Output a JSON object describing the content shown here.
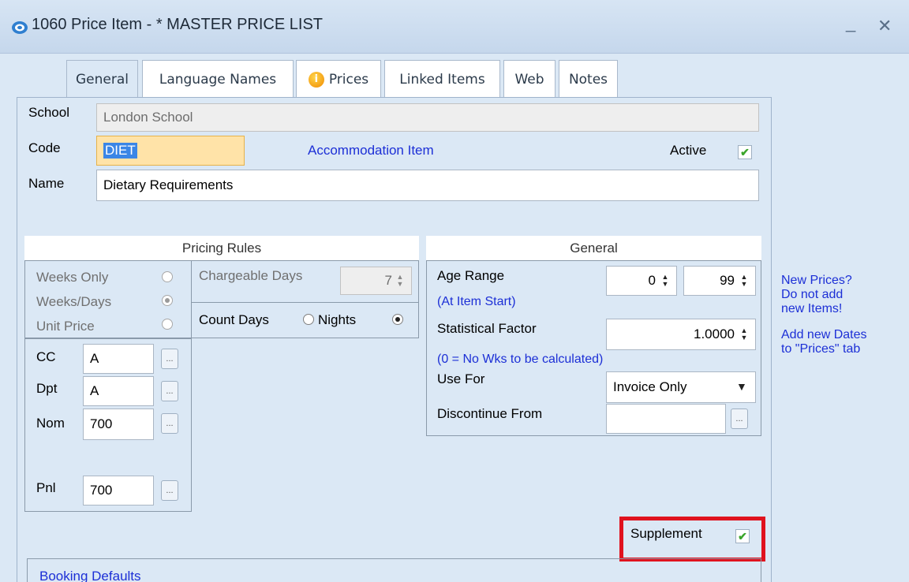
{
  "window": {
    "title": "1060 Price Item - * MASTER PRICE LIST",
    "minimize_glyph": "_",
    "close_glyph": "✕"
  },
  "tabs": [
    {
      "label": "General"
    },
    {
      "label": "Language Names"
    },
    {
      "label": "Prices",
      "icon": "info-icon"
    },
    {
      "label": "Linked Items"
    },
    {
      "label": "Web"
    },
    {
      "label": "Notes"
    }
  ],
  "form": {
    "school_label": "School",
    "school_value": "London School",
    "code_label": "Code",
    "code_value": "DIET",
    "item_type": "Accommodation Item",
    "active_label": "Active",
    "active_checked": true,
    "name_label": "Name",
    "name_value": "Dietary Requirements"
  },
  "pricing_rules": {
    "title": "Pricing Rules",
    "weeks_only": "Weeks Only",
    "weeks_days": "Weeks/Days",
    "unit_price": "Unit Price",
    "selected": "Weeks/Days",
    "chargeable_days_label": "Chargeable Days",
    "chargeable_days_value": "7",
    "count_label": "Count Days",
    "nights_label": "Nights",
    "count_selected": "Nights",
    "cc_label": "CC",
    "cc_value": "A",
    "dpt_label": "Dpt",
    "dpt_value": "A",
    "nom_label": "Nom",
    "nom_value": "700",
    "pnl_label": "Pnl",
    "pnl_value": "700",
    "ellipsis": "..."
  },
  "general_group": {
    "title": "General",
    "age_range_label": "Age Range",
    "age_min": "0",
    "age_max": "99",
    "age_note": "(At Item Start)",
    "stat_factor_label": "Statistical Factor",
    "stat_factor_value": "1.0000",
    "stat_note": "(0 = No  Wks to be calculated)",
    "use_for_label": "Use For",
    "use_for_value": "Invoice Only",
    "discontinue_label": "Discontinue From",
    "discontinue_value": ""
  },
  "side_note": {
    "line1": "New Prices?",
    "line2": "Do not add",
    "line3": "new Items!",
    "line4": "Add new Dates",
    "line5": "to \"Prices\" tab"
  },
  "supplement": {
    "label": "Supplement",
    "checked": true
  },
  "booking_defaults": {
    "label": "Booking Defaults"
  },
  "colors": {
    "highlight": "#e0121e",
    "link_blue": "#1c2fd6",
    "code_bg": "#ffe3a8"
  }
}
